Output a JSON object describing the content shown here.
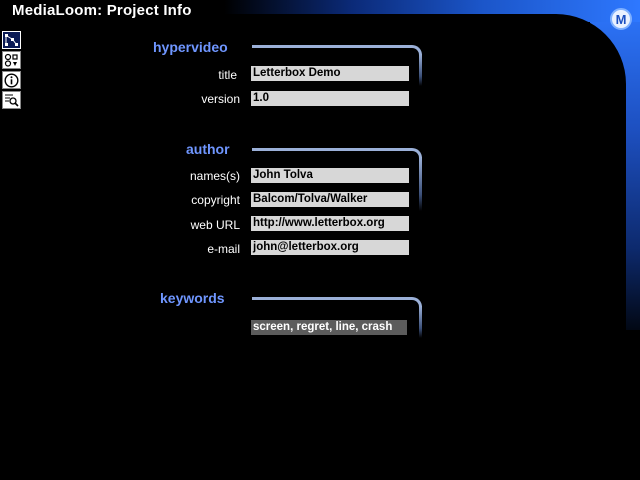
{
  "window": {
    "title": "MediaLoom: Project Info",
    "logo_letter": "M"
  },
  "toolbar": {
    "items": [
      {
        "name": "map-view-icon",
        "active": true
      },
      {
        "name": "tools-icon",
        "active": false
      },
      {
        "name": "info-icon",
        "active": false
      },
      {
        "name": "search-list-icon",
        "active": false
      }
    ]
  },
  "hypervideo": {
    "heading": "hypervideo",
    "title_label": "title",
    "title_value": "Letterbox Demo",
    "version_label": "version",
    "version_value": "1.0"
  },
  "author": {
    "heading": "author",
    "names_label": "names(s)",
    "names_value": "John Tolva",
    "copyright_label": "copyright",
    "copyright_value": "Balcom/Tolva/Walker",
    "url_label": "web URL",
    "url_value": "http://www.letterbox.org",
    "email_label": "e-mail",
    "email_value": "john@letterbox.org"
  },
  "keywords": {
    "heading": "keywords",
    "value": "screen, regret, line, crash"
  },
  "colors": {
    "accent": "#6f96ff",
    "chrome_blue": "#2e78ff",
    "field_bg": "#d7d7d7"
  }
}
